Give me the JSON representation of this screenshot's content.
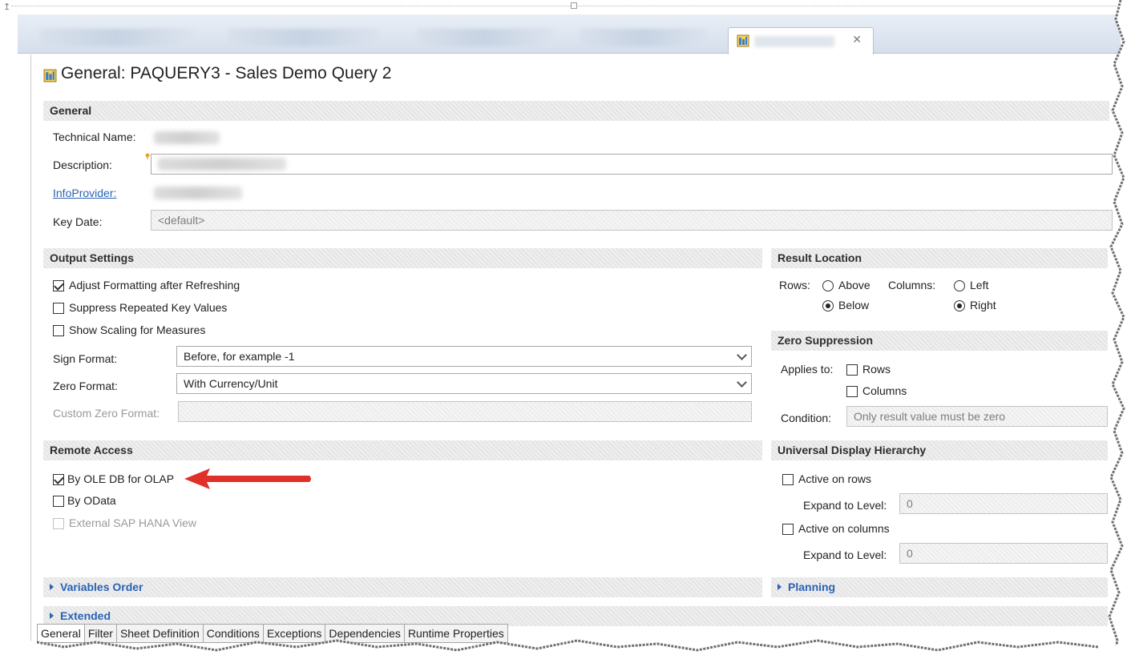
{
  "window": {
    "title": "General: PAQUERY3 - Sales Demo Query 2",
    "active_tab_close": "✕"
  },
  "general": {
    "header": "General",
    "technical_name_label": "Technical Name:",
    "description_label": "Description:",
    "infoprovider_label": "InfoProvider:",
    "key_date_label": "Key Date:",
    "key_date_value": "<default>"
  },
  "output_settings": {
    "header": "Output Settings",
    "adjust_formatting": {
      "label": "Adjust Formatting after Refreshing",
      "checked": true
    },
    "suppress_repeated": {
      "label": "Suppress Repeated Key Values",
      "checked": false
    },
    "show_scaling": {
      "label": "Show Scaling for Measures",
      "checked": false
    },
    "sign_format_label": "Sign Format:",
    "sign_format_value": "Before, for example -1",
    "zero_format_label": "Zero Format:",
    "zero_format_value": "With Currency/Unit",
    "custom_zero_format_label": "Custom Zero Format:"
  },
  "remote_access": {
    "header": "Remote Access",
    "ole_db": {
      "label": "By OLE DB for OLAP",
      "checked": true
    },
    "odata": {
      "label": "By OData",
      "checked": false
    },
    "hana_view": {
      "label": "External SAP HANA View",
      "checked": false,
      "disabled": true
    }
  },
  "result_location": {
    "header": "Result Location",
    "rows_label": "Rows:",
    "rows_above": "Above",
    "rows_below": "Below",
    "rows_selected": "Below",
    "columns_label": "Columns:",
    "columns_left": "Left",
    "columns_right": "Right",
    "columns_selected": "Right"
  },
  "zero_suppression": {
    "header": "Zero Suppression",
    "applies_to_label": "Applies to:",
    "rows": "Rows",
    "columns": "Columns",
    "condition_label": "Condition:",
    "condition_value": "Only result value must be zero"
  },
  "universal_display_hierarchy": {
    "header": "Universal Display Hierarchy",
    "active_on_rows": "Active on rows",
    "expand_to_level_label": "Expand to Level:",
    "rows_level": "0",
    "active_on_columns": "Active on columns",
    "columns_level": "0"
  },
  "collapsed_sections": {
    "variables_order": "Variables Order",
    "planning": "Planning",
    "extended": "Extended"
  },
  "bottom_tabs": [
    "General",
    "Filter",
    "Sheet Definition",
    "Conditions",
    "Exceptions",
    "Dependencies",
    "Runtime Properties"
  ],
  "colors": {
    "accent_link": "#2a63b5",
    "annotation_arrow": "#e0302a",
    "section_header_bg": "#e4e4e4"
  }
}
